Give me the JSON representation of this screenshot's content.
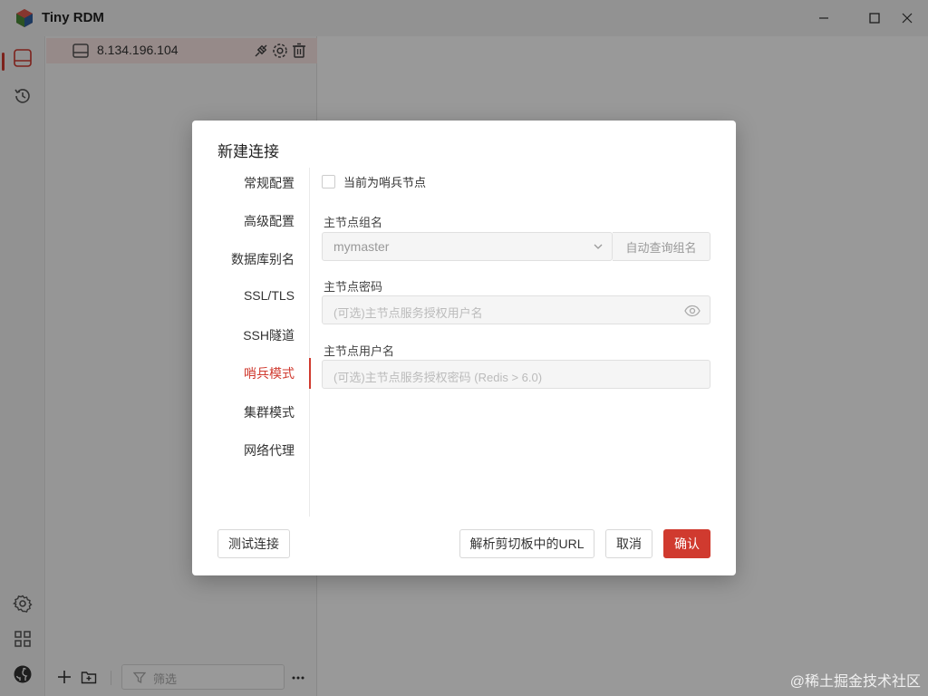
{
  "app": {
    "title": "Tiny RDM"
  },
  "sidebar": {
    "connection": {
      "label": "8.134.196.104"
    },
    "filter_placeholder": "筛选"
  },
  "dialog": {
    "title": "新建连接",
    "tabs": [
      {
        "label": "常规配置"
      },
      {
        "label": "高级配置"
      },
      {
        "label": "数据库别名"
      },
      {
        "label": "SSL/TLS"
      },
      {
        "label": "SSH隧道"
      },
      {
        "label": "哨兵模式"
      },
      {
        "label": "集群模式"
      },
      {
        "label": "网络代理"
      }
    ],
    "active_tab": "哨兵模式",
    "sentinel_checkbox_label": "当前为哨兵节点",
    "fields": {
      "group_name": {
        "label": "主节点组名",
        "value": "mymaster",
        "addon": "自动查询组名"
      },
      "password": {
        "label": "主节点密码",
        "placeholder": "(可选)主节点服务授权用户名"
      },
      "username": {
        "label": "主节点用户名",
        "placeholder": "(可选)主节点服务授权密码 (Redis > 6.0)"
      }
    },
    "buttons": {
      "test": "测试连接",
      "parse_url": "解析剪切板中的URL",
      "cancel": "取消",
      "confirm": "确认"
    }
  },
  "watermark": "@稀土掘金技术社区",
  "colors": {
    "accent": "#d03a2f"
  }
}
